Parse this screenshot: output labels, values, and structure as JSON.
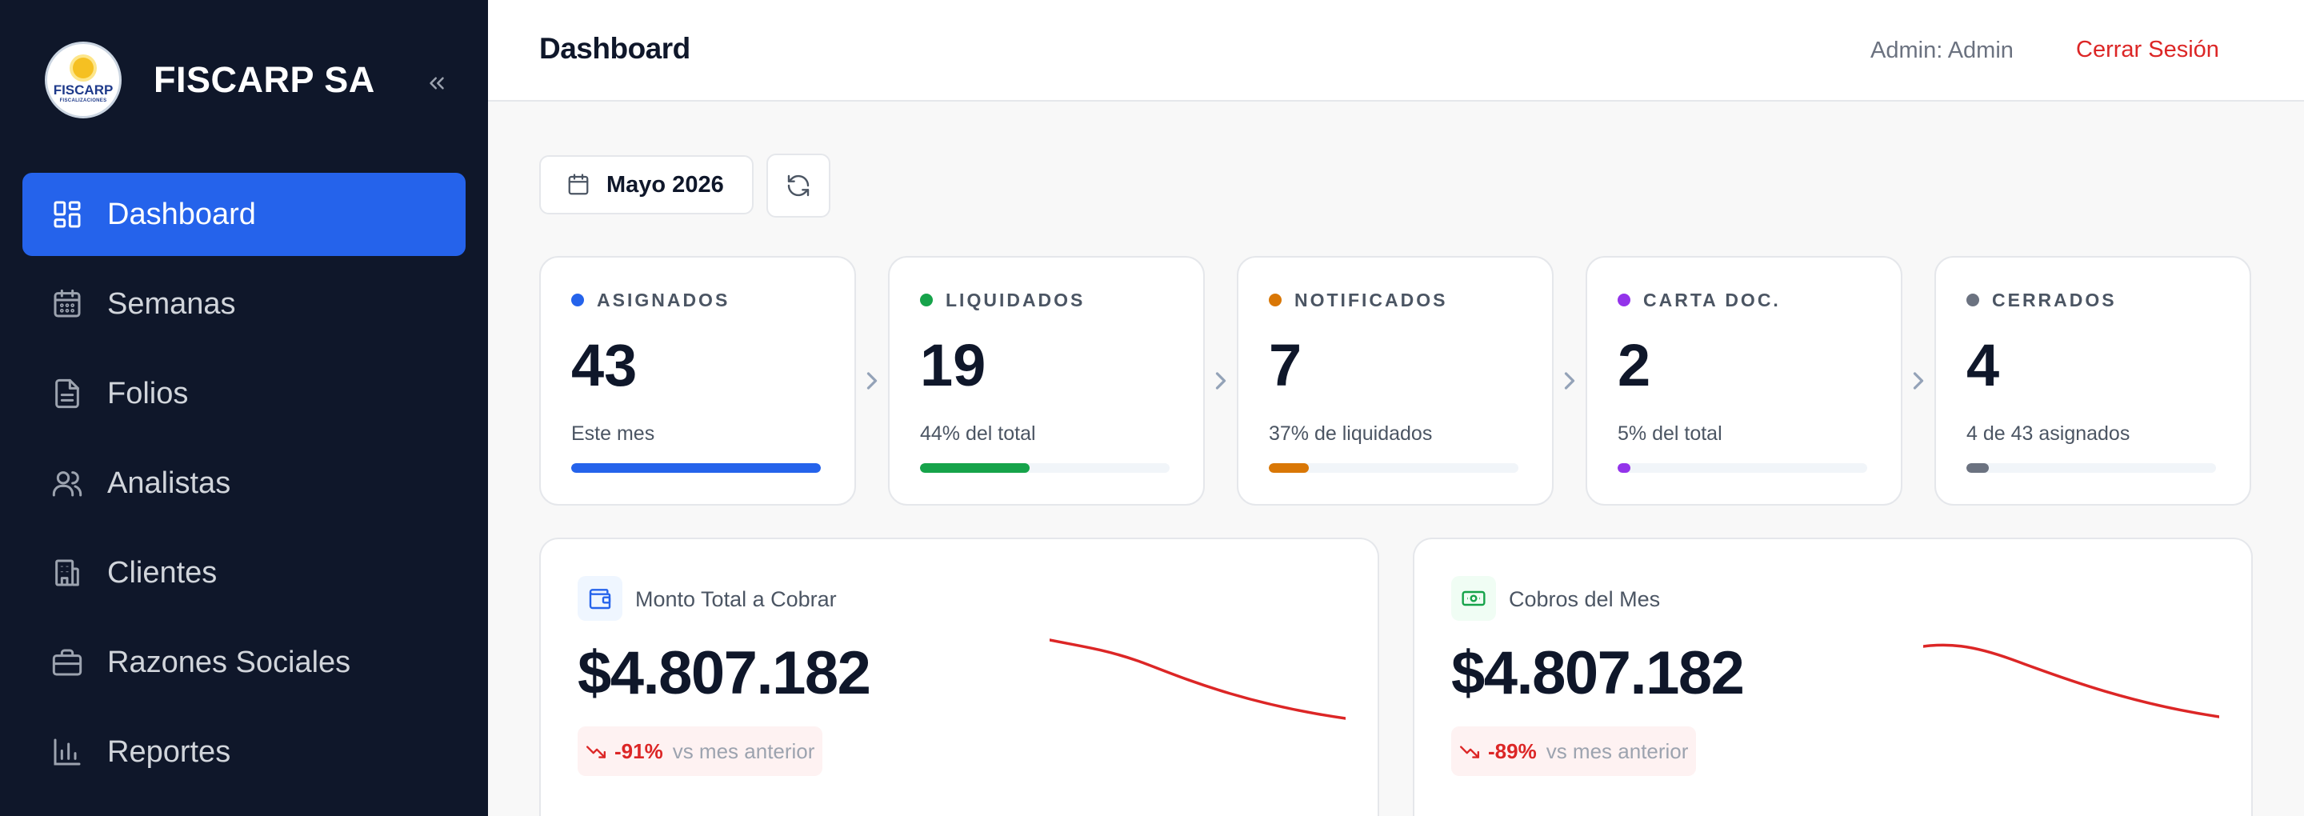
{
  "sidebar": {
    "logo_text": "FISCARP",
    "logo_subtext": "FISCALIZACIONES",
    "brand": "FISCARP SA",
    "items": [
      {
        "label": "Dashboard",
        "icon": "grid-icon",
        "active": true
      },
      {
        "label": "Semanas",
        "icon": "calendar-icon",
        "active": false
      },
      {
        "label": "Folios",
        "icon": "document-icon",
        "active": false
      },
      {
        "label": "Analistas",
        "icon": "users-icon",
        "active": false
      },
      {
        "label": "Clientes",
        "icon": "building-icon",
        "active": false
      },
      {
        "label": "Razones Sociales",
        "icon": "briefcase-icon",
        "active": false
      },
      {
        "label": "Reportes",
        "icon": "bar-chart-icon",
        "active": false
      }
    ]
  },
  "header": {
    "title": "Dashboard",
    "user": "Admin: Admin",
    "logout": "Cerrar Sesión"
  },
  "toolbar": {
    "month": "Mayo 2026"
  },
  "stats": [
    {
      "label": "ASIGNADOS",
      "value": "43",
      "sub": "Este mes",
      "color": "#2563eb",
      "fill": 1.0
    },
    {
      "label": "LIQUIDADOS",
      "value": "19",
      "sub": "44% del total",
      "color": "#16a34a",
      "fill": 0.44
    },
    {
      "label": "NOTIFICADOS",
      "value": "7",
      "sub": "37% de liquidados",
      "color": "#d97706",
      "fill": 0.16
    },
    {
      "label": "CARTA DOC.",
      "value": "2",
      "sub": "5% del total",
      "color": "#9333ea",
      "fill": 0.05
    },
    {
      "label": "CERRADOS",
      "value": "4",
      "sub": "4 de 43 asignados",
      "color": "#6b7280",
      "fill": 0.09
    }
  ],
  "money": [
    {
      "title": "Monto Total a Cobrar",
      "value": "$4.807.182",
      "change": "-91%",
      "vs": "vs mes anterior",
      "icon": "wallet-icon",
      "icon_color": "#2563eb",
      "icon_bg": "#eff6ff"
    },
    {
      "title": "Cobros del Mes",
      "value": "$4.807.182",
      "change": "-89%",
      "vs": "vs mes anterior",
      "icon": "banknote-icon",
      "icon_color": "#16a34a",
      "icon_bg": "#f0fdf4"
    }
  ],
  "colors": {
    "sidebar_bg": "#0f172a",
    "accent": "#2563eb",
    "danger": "#dc2626"
  }
}
